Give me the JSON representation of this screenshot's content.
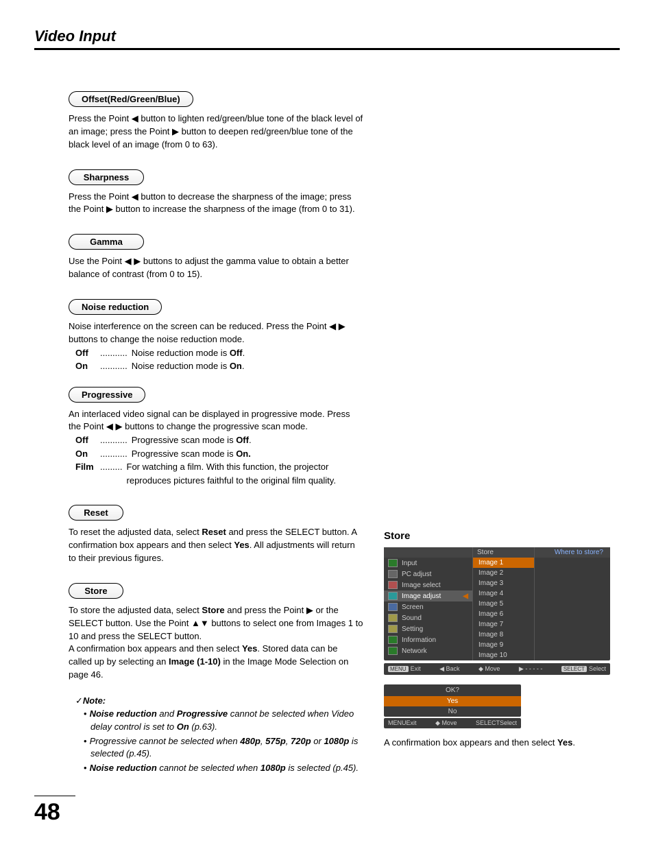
{
  "pageTitle": "Video Input",
  "pageNumber": "48",
  "offset": {
    "label": "Offset(Red/Green/Blue)",
    "t1": "Press the Point ◀ button to lighten red/green/blue tone of the black level of an image; press the Point ▶ button to deepen red/green/blue tone of the black level of an image (from 0 to 63)."
  },
  "sharpness": {
    "label": "Sharpness",
    "t1": "Press the Point ◀ button to decrease the sharpness of the image; press the Point ▶ button to increase the sharpness of the image (from 0 to 31)."
  },
  "gamma": {
    "label": "Gamma",
    "t1": "Use the Point ◀ ▶ buttons to adjust the gamma value to obtain a better balance of contrast (from 0 to 15)."
  },
  "noise": {
    "label": "Noise reduction",
    "t1": "Noise interference on the screen can be reduced. Press the Point ◀ ▶ buttons to change the noise reduction mode.",
    "opts": [
      {
        "k": "Off",
        "d": "...........",
        "v_a": "Noise reduction mode is ",
        "v_b": "Off",
        "v_c": "."
      },
      {
        "k": "On",
        "d": "...........",
        "v_a": "Noise reduction mode is ",
        "v_b": "On",
        "v_c": "."
      }
    ]
  },
  "progressive": {
    "label": "Progressive",
    "t1": "An interlaced video signal can be displayed in progressive mode. Press the Point ◀ ▶ buttons to change the progressive scan mode.",
    "opts": [
      {
        "k": "Off",
        "d": "...........",
        "v_a": "Progressive scan mode is ",
        "v_b": "Off",
        "v_c": "."
      },
      {
        "k": "On",
        "d": "...........",
        "v_a": "Progressive scan mode is ",
        "v_b": "On.",
        "v_c": ""
      },
      {
        "k": "Film",
        "d": ".........",
        "v_a": "For watching a film. With this function, the projector reproduces pictures faithful to the original film quality.",
        "v_b": "",
        "v_c": ""
      }
    ]
  },
  "reset": {
    "label": "Reset",
    "t_a": "To reset the adjusted data, select ",
    "t_b": "Reset",
    "t_c": " and press the SELECT button. A confirmation box appears and then select ",
    "t_d": "Yes",
    "t_e": ". All adjustments will return to their previous figures."
  },
  "store": {
    "label": "Store",
    "p1_a": "To store the adjusted data, select ",
    "p1_b": "Store",
    "p1_c": " and press the Point ▶ or the SELECT button. Use the Point ▲▼ buttons to select one from Images 1 to 10 and press the SELECT button.",
    "p2_a": "A confirmation box appears and then select ",
    "p2_b": "Yes",
    "p2_c": ". Stored data can be called up by selecting an ",
    "p2_d": "Image (1-10)",
    "p2_e": " in the Image Mode Selection on page 46."
  },
  "note": {
    "head": "Note:",
    "items": [
      {
        "pre": "",
        "b1": "Noise reduction",
        "mid": " and ",
        "b2": "Progressive",
        "post_a": " cannot be selected when Video delay control is set to ",
        "b3": "On",
        "post_b": " (p.63)."
      },
      {
        "pre": "Progressive cannot be selected when ",
        "b1": "480p",
        "mid": ", ",
        "b2": "575p",
        "mid2": ", ",
        "b3": "720p",
        "mid3": " or ",
        "b4": "1080p",
        "post": " is selected (p.45)."
      },
      {
        "pre": "",
        "b1": "Noise reduction",
        "mid": " cannot be selected when ",
        "b2": "1080p",
        "post": " is selected (p.45)."
      }
    ]
  },
  "osd": {
    "title": "Store",
    "leftCol": [
      {
        "label": "Input",
        "ic": "g"
      },
      {
        "label": "PC adjust",
        "ic": ""
      },
      {
        "label": "Image select",
        "ic": "r"
      },
      {
        "label": "Image adjust",
        "ic": "c",
        "hl": true
      },
      {
        "label": "Screen",
        "ic": "b"
      },
      {
        "label": "Sound",
        "ic": "y"
      },
      {
        "label": "Setting",
        "ic": "y"
      },
      {
        "label": "Information",
        "ic": "g"
      },
      {
        "label": "Network",
        "ic": "g"
      }
    ],
    "midTitle": "Store",
    "midItems": [
      "Image 1",
      "Image 2",
      "Image 3",
      "Image 4",
      "Image 5",
      "Image 6",
      "Image 7",
      "Image 8",
      "Image 9",
      "Image 10"
    ],
    "rightTitle": "Where to store?",
    "footer": {
      "exit": "Exit",
      "back": "Back",
      "move": "Move",
      "dash": "- - - - -",
      "select": "Select"
    },
    "menuKey": "MENU",
    "selectKey": "SELECT"
  },
  "confirm": {
    "q": "OK?",
    "yes": "Yes",
    "no": "No",
    "exit": "Exit",
    "move": "Move",
    "select": "Select",
    "menuKey": "MENU",
    "selectKey": "SELECT"
  },
  "caption_a": "A confirmation box appears and then select ",
  "caption_b": "Yes",
  "caption_c": "."
}
